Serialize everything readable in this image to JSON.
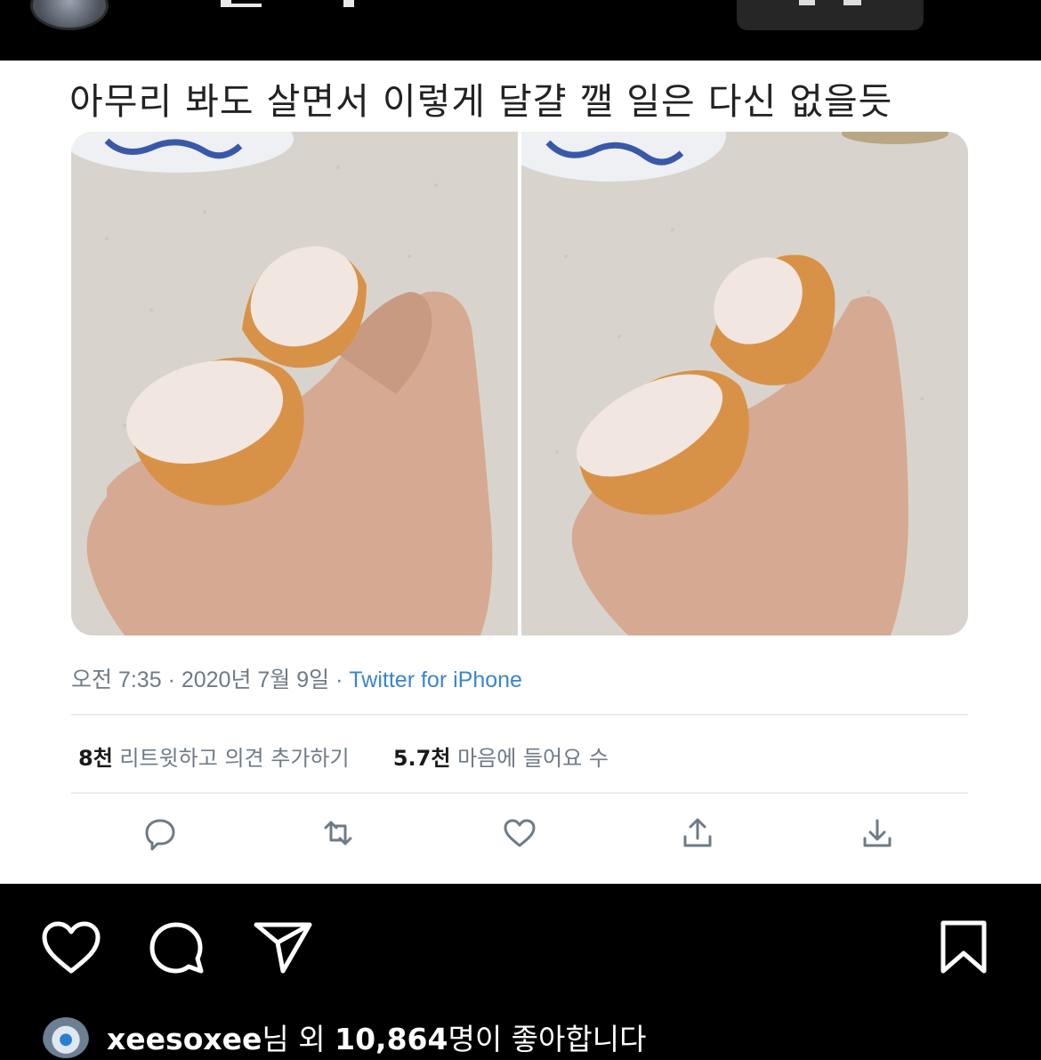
{
  "tweet": {
    "text": "아무리 봐도 살면서 이렇게 달걀 깰 일은 다신 없을듯",
    "meta": {
      "time": "오전 7:35",
      "separator": "·",
      "date": "2020년 7월 9일",
      "source": "Twitter for iPhone"
    },
    "stats": {
      "retweets_count": "8천",
      "retweets_label": "리트윗하고 의견 추가하기",
      "likes_count": "5.7천",
      "likes_label": "마음에 들어요 수"
    },
    "photos": [
      {
        "icon": "eggshell-photo"
      },
      {
        "icon": "eggshell-photo"
      }
    ],
    "actions": [
      "reply-icon",
      "retweet-icon",
      "like-icon",
      "share-icon",
      "download-icon"
    ]
  },
  "instagram": {
    "actions": [
      "heart-icon",
      "comment-icon",
      "send-icon",
      "bookmark-icon"
    ],
    "likes": {
      "user": "xeesoxee",
      "mid": "님 외 ",
      "count": "10,864",
      "suffix": "명이 좋아합니다"
    }
  },
  "colors": {
    "background": "#000000",
    "card": "#ffffff",
    "link": "#3b86c8",
    "muted": "#6e7b86"
  }
}
